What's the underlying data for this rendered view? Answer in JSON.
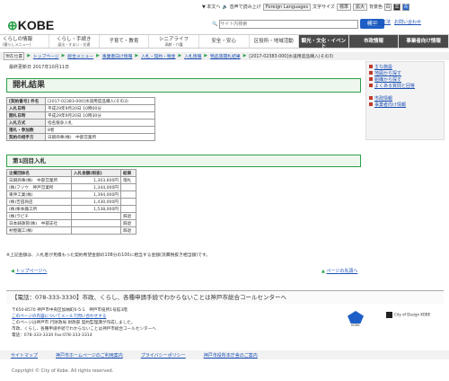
{
  "header": {
    "logo": "KOBE",
    "utility": {
      "size_label": "▼ 本文へ",
      "voice_label": "音声で読み上げ",
      "lang_label": "Foreign Languages",
      "textsize_label": "文字サイズ",
      "std": "標準",
      "large": "拡大",
      "color_label": "背景色",
      "colors": [
        "白",
        "黒",
        "青"
      ]
    },
    "search_placeholder": "サイト内検索",
    "search_button": "検索",
    "search_help": "検索方法",
    "contact": "お問い合わせ"
  },
  "nav": [
    {
      "main": "くらしの情報",
      "sub": "(暮らしメニュー)",
      "dark": false
    },
    {
      "main": "くらし・手続き",
      "sub": "届出・すまい・交通",
      "dark": false
    },
    {
      "main": "子育て・教育",
      "sub": "",
      "dark": false
    },
    {
      "main": "シニアライフ",
      "sub": "高齢・介護",
      "dark": false
    },
    {
      "main": "安全・安心",
      "sub": "",
      "dark": false
    },
    {
      "main": "区役所・地域活動",
      "sub": "",
      "dark": false
    },
    {
      "main": "観光・文化・イベント",
      "sub": "",
      "dark": true
    },
    {
      "main": "市政情報",
      "sub": "",
      "dark": true
    },
    {
      "main": "事業者向け情報",
      "sub": "",
      "dark": true
    }
  ],
  "breadcrumb": {
    "here": "現在位置",
    "items": [
      "トップページ",
      "総合メニュー",
      "事業者向け情報",
      "入札・契約・税金",
      "入札情報",
      "物品等開札結果",
      "[2017-02383-000]水道用度品購入(その3)"
    ]
  },
  "updated": "最終更新日 2017年10月11日",
  "page_title": "開札結果",
  "sidebar": {
    "group1": [
      "主な施設",
      "地図から探す",
      "組織から探す",
      "よくある質問と回答"
    ],
    "group2": [
      "市政情報",
      "事業者向け情報"
    ]
  },
  "info_table": [
    {
      "k": "[契約番号] 件名",
      "v": "[2017-02383-000]水道用度品購入(その3)"
    },
    {
      "k": "入札日時",
      "v": "平成29年9月20日 10時00分"
    },
    {
      "k": "開札日時",
      "v": "平成29年9月20日 10時30分"
    },
    {
      "k": "入札方式",
      "v": "指名競争入札"
    },
    {
      "k": "落札・参加数",
      "v": "8者"
    },
    {
      "k": "契約の相手方",
      "v": "日鋼商事(株)　中部営業所"
    }
  ],
  "section_title": "第1回目入札",
  "bid_headers": [
    "企業団体名",
    "入札金額(税抜)",
    "結果"
  ],
  "bids": [
    {
      "name": "日鋼商事(株)　中部営業所",
      "amount": "1,303,600円",
      "result": "落札"
    },
    {
      "name": "(株)フソウ　神戸営業所",
      "amount": "1,344,000円",
      "result": ""
    },
    {
      "name": "東伸工業(株)",
      "amount": "1,394,000円",
      "result": ""
    },
    {
      "name": "(株)吉田商店",
      "amount": "1,430,000円",
      "result": ""
    },
    {
      "name": "(株)栗本鐵工所",
      "amount": "1,538,000円",
      "result": ""
    },
    {
      "name": "(株)ラピチ",
      "amount": "",
      "result": "辞退"
    },
    {
      "name": "日本鋳鉄管(株)　中部支社",
      "amount": "",
      "result": "辞退"
    },
    {
      "name": "村樫鐵工(株)",
      "amount": "",
      "result": "辞退"
    }
  ],
  "note": "※上記金額は、入札者が見積もった契約希望金額の108分の100に相当する金額(消費税抜き相当額)です。",
  "pager": {
    "prev": "トップページへ",
    "next": "ページの先頭へ"
  },
  "tel_banner": "【電話：078-333-3330】市政、くらし、各種申請手続でわからないことは神戸市総合コールセンターへ",
  "address": [
    "〒650-8570 神戸市中央区加納町6-5-1　神戸市役所1号館3階",
    "このページの内容についてメールで問い合わせする",
    "このページは神戸市 行財政局 財政部 契約監理課が作成しました。",
    "市政、くらし、各種申請手続でわからないことは神戸市総合コールセンターへ",
    "電話：078-333-3330 Fax:078-333-3314"
  ],
  "seal_text": "KOBE",
  "design_text": "City of Design KOBE",
  "footer_links": [
    "サイトマップ",
    "神戸市ホームページのご利用案内",
    "プライバシーポリシー",
    "神戸市役所本庁舎のご案内"
  ],
  "copyright": "Copyright © City of Kobe. All rights reserved."
}
